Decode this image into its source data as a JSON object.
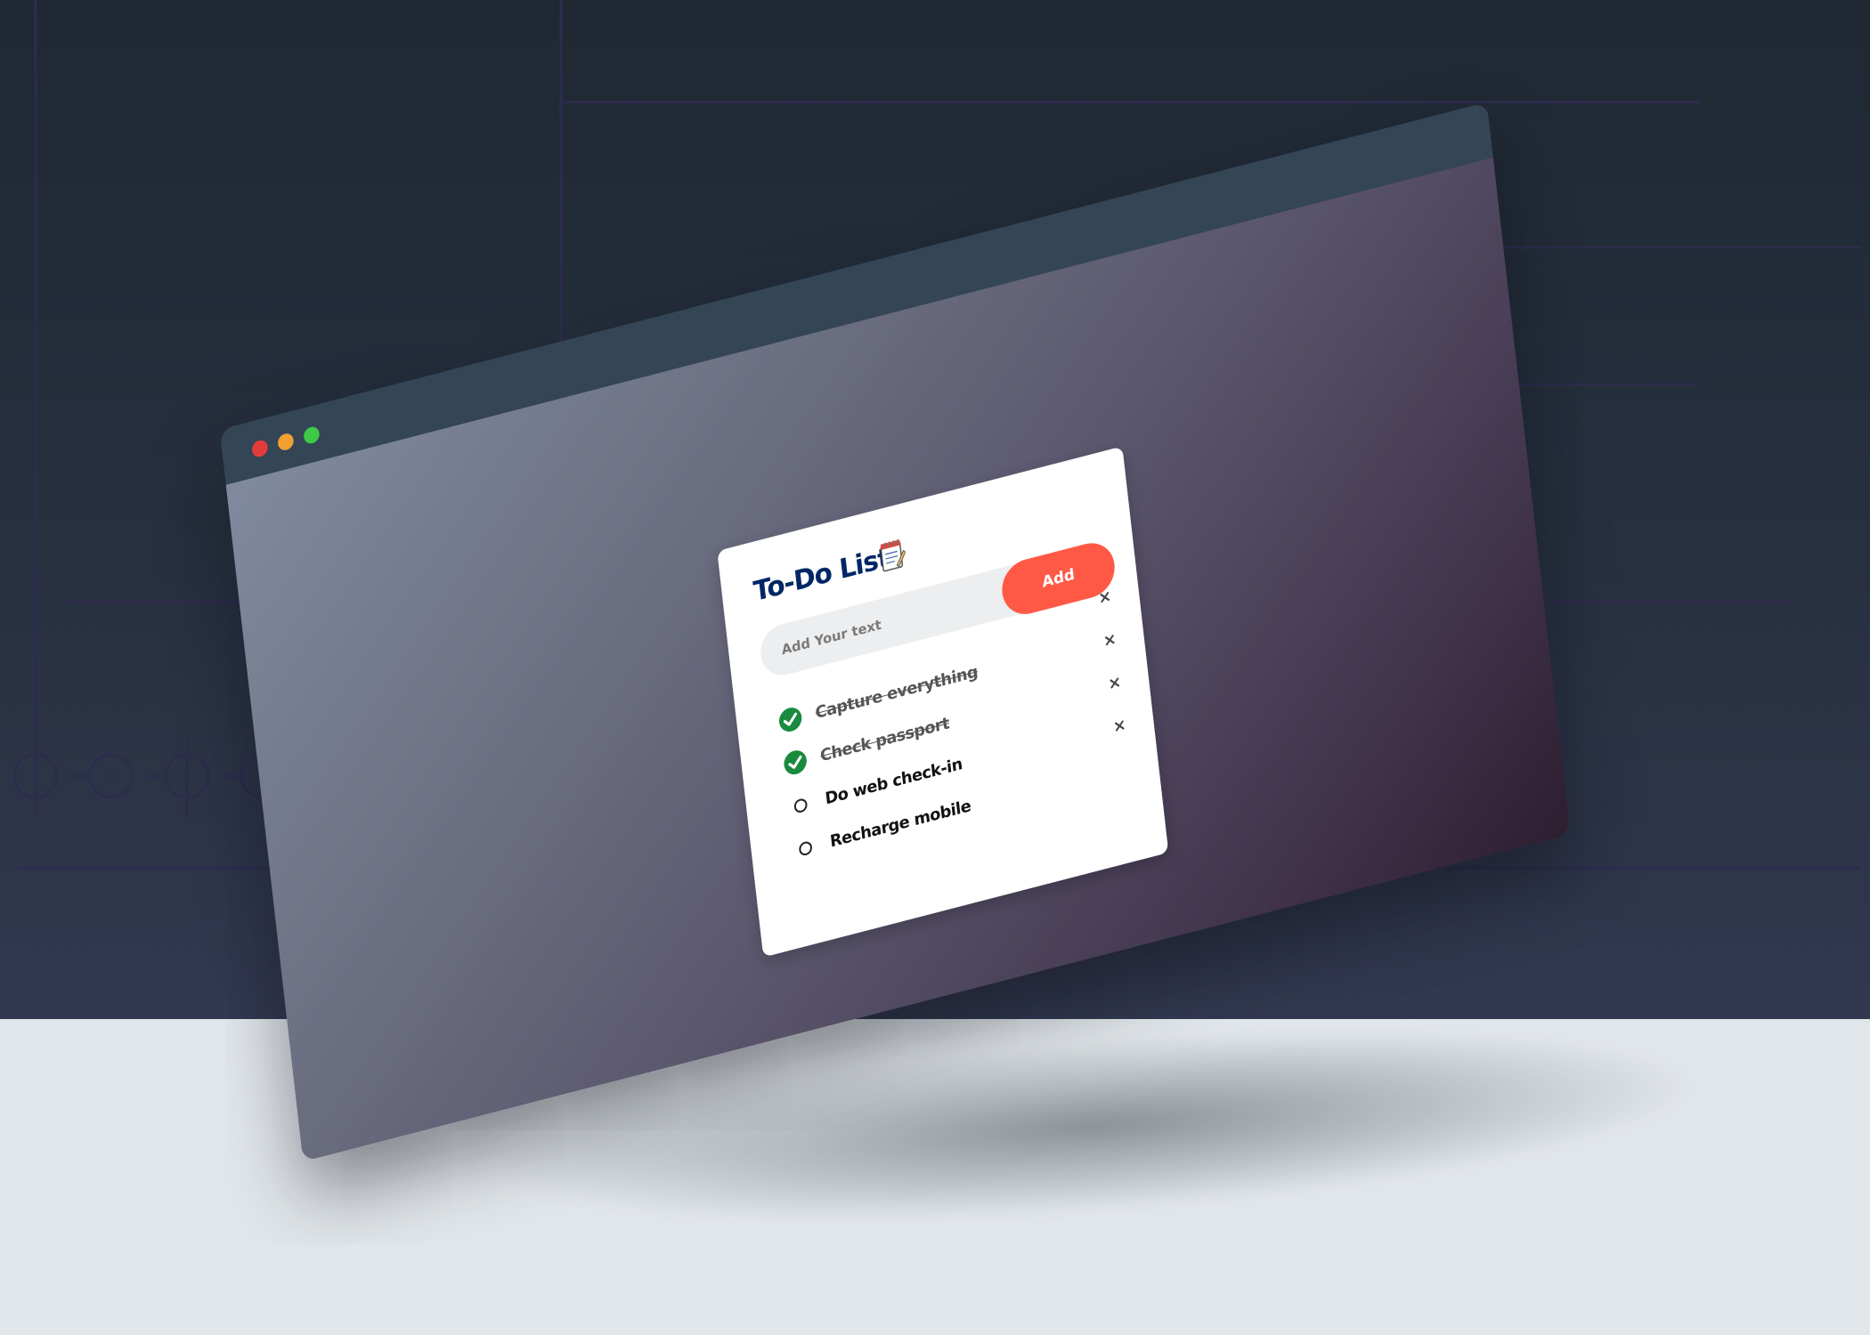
{
  "window": {
    "controls": [
      "close",
      "minimize",
      "maximize"
    ]
  },
  "todo": {
    "title": "To-Do List",
    "title_icon": "notepad-icon",
    "input_placeholder": "Add Your text",
    "add_label": "Add",
    "remove_label": "×",
    "tasks": [
      {
        "text": "Capture everything",
        "done": true
      },
      {
        "text": "Check passport",
        "done": true
      },
      {
        "text": "Do web check-in",
        "done": false
      },
      {
        "text": "Recharge mobile",
        "done": false
      }
    ]
  },
  "colors": {
    "title": "#002765",
    "add_button": "#ff5945",
    "check_done": "#1a8a3f",
    "chrome_bar": "#344556"
  }
}
